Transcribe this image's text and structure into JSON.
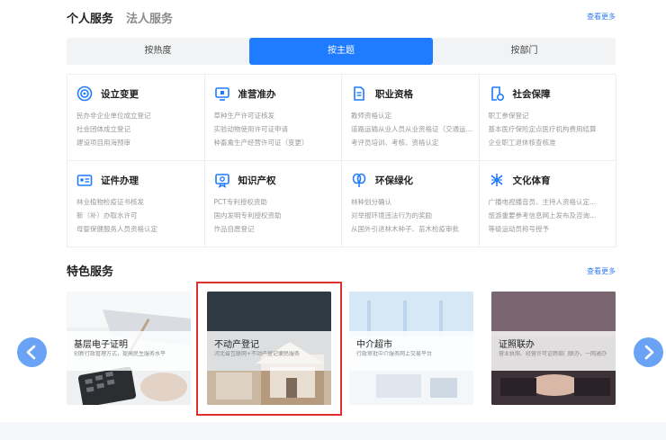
{
  "header": {
    "tabs": [
      {
        "label": "个人服务"
      },
      {
        "label": "法人服务"
      }
    ],
    "more": "查看更多"
  },
  "segments": [
    {
      "label": "按热度"
    },
    {
      "label": "按主题"
    },
    {
      "label": "按部门"
    }
  ],
  "accent_color": "#1f7bff",
  "categories": [
    {
      "title": "设立变更",
      "icon": "target-icon",
      "items": [
        "民办非企业单位成立登记",
        "社会团体成立登记",
        "建设项目用海预审"
      ]
    },
    {
      "title": "准营准办",
      "icon": "monitor-icon",
      "items": [
        "草种生产许可证核发",
        "实验动物使用许可证申请",
        "种畜禽生产经营许可证（变更）"
      ]
    },
    {
      "title": "职业资格",
      "icon": "document-icon",
      "items": [
        "教师资格认定",
        "道路运输从业人员从业资格证（交通运输工程）初始...",
        "考评员培训、考核、资格认定"
      ]
    },
    {
      "title": "社会保障",
      "icon": "social-security-icon",
      "items": [
        "职工参保登记",
        "基本医疗保险定点医疗机构费用结算",
        "企业职工退休核查核准"
      ]
    },
    {
      "title": "证件办理",
      "icon": "id-card-icon",
      "items": [
        "林业植物检疫证书核发",
        "新（补）办取水许可",
        "母婴保健服务人员资格认定"
      ]
    },
    {
      "title": "知识产权",
      "icon": "ip-certificate-icon",
      "items": [
        "PCT专利授权资助",
        "国内发明专利授权资助",
        "作品自愿登记"
      ]
    },
    {
      "title": "环保绿化",
      "icon": "leaf-icon",
      "items": [
        "林种划分确认",
        "对举报环境违法行为的奖励",
        "从国外引进林木种子、苗木检疫审批"
      ]
    },
    {
      "title": "文化体育",
      "icon": "sports-icon",
      "items": [
        "广播电视播音员、主持人资格认定...",
        "旅游重要参考信息网上发布及咨询...",
        "等级运动员称号授予"
      ]
    }
  ],
  "featured": {
    "title": "特色服务",
    "more": "查看更多",
    "cards": [
      {
        "title": "基层电子证明",
        "desc": "创新行政管理方式，提高民生服务水平"
      },
      {
        "title": "不动产登记",
        "desc": "河北省互联网+不动产登记便民服务"
      },
      {
        "title": "中介超市",
        "desc": "行政审批中介服务网上交易平台"
      },
      {
        "title": "证照联办",
        "desc": "营业执照、经营许可证跨部门联办，一网通办"
      }
    ]
  }
}
